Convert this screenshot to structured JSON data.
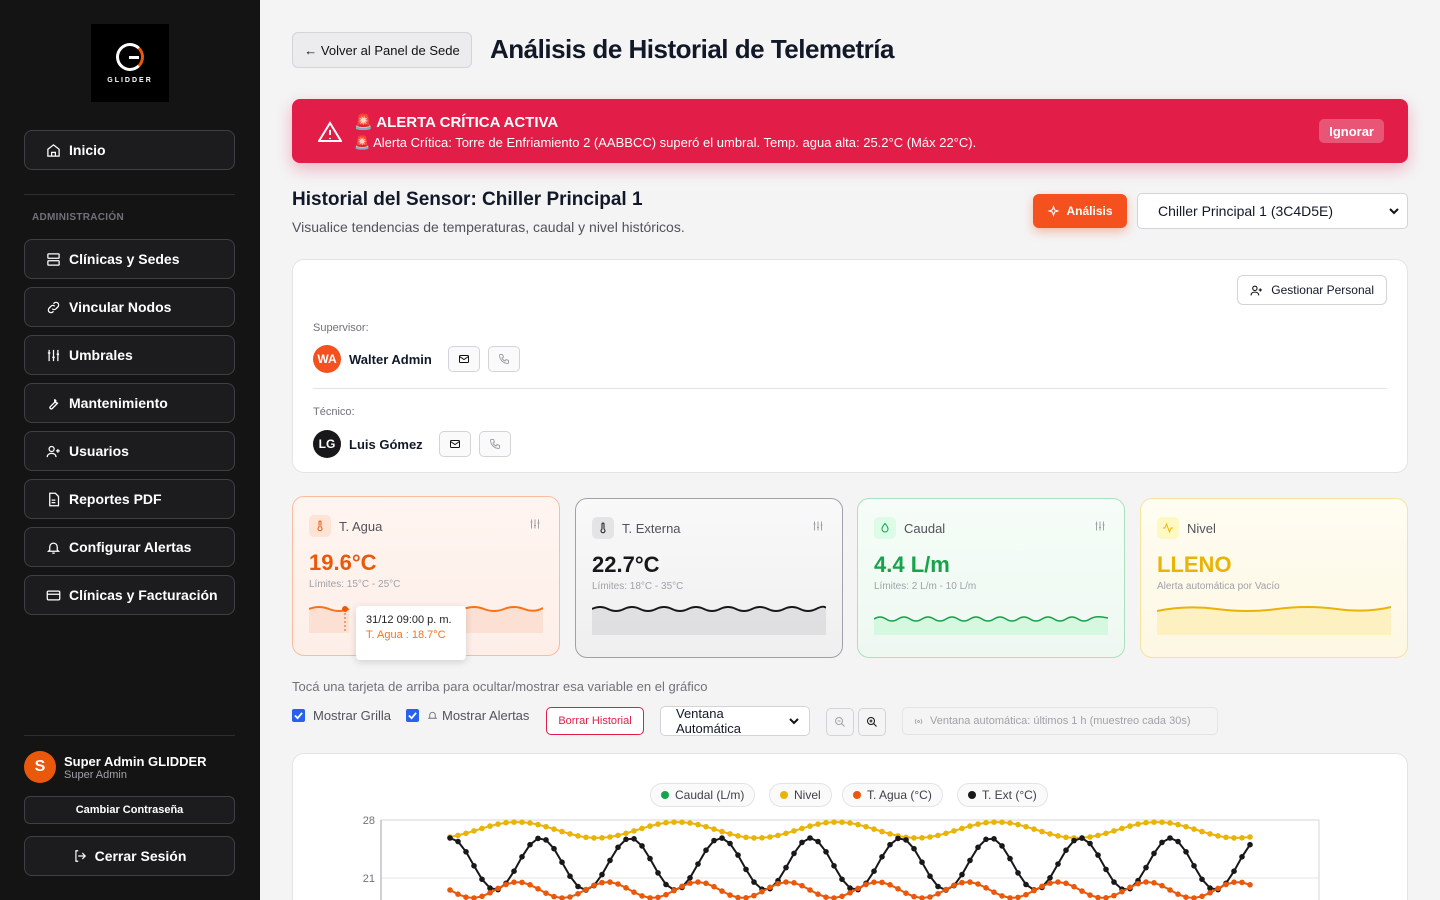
{
  "sidebar": {
    "logo_text": "GLIDDER",
    "home": "Inicio",
    "section_title": "ADMINISTRACIÓN",
    "items": [
      {
        "label": "Clínicas y Sedes",
        "icon": "server-icon"
      },
      {
        "label": "Vincular Nodos",
        "icon": "link-icon"
      },
      {
        "label": "Umbrales",
        "icon": "sliders-icon"
      },
      {
        "label": "Mantenimiento",
        "icon": "wrench-icon"
      },
      {
        "label": "Usuarios",
        "icon": "user-plus-icon"
      },
      {
        "label": "Reportes PDF",
        "icon": "file-icon"
      },
      {
        "label": "Configurar Alertas",
        "icon": "bell-icon"
      },
      {
        "label": "Clínicas y Facturación",
        "icon": "credit-card-icon"
      }
    ],
    "user": {
      "initial": "S",
      "name": "Super Admin GLIDDER",
      "role": "Super Admin"
    },
    "change_password": "Cambiar Contraseña",
    "logout": "Cerrar Sesión"
  },
  "header": {
    "back": "← Volver al Panel de Sede",
    "title": "Análisis de Historial de Telemetría"
  },
  "alert": {
    "title": "🚨 ALERTA CRÍTICA ACTIVA",
    "message": "🚨 Alerta Crítica: Torre de Enfriamiento 2 (AABBCC) superó el umbral. Temp. agua alta: 25.2°C (Máx 22°C).",
    "dismiss": "Ignorar",
    "color": "#e11d48"
  },
  "sensor": {
    "title": "Historial del Sensor: Chiller Principal 1",
    "subtitle": "Visualice tendencias de temperaturas, caudal y nivel históricos.",
    "analysis_btn": "Análisis",
    "selected": "Chiller Principal 1 (3C4D5E)"
  },
  "staff": {
    "manage": "Gestionar Personal",
    "supervisor_label": "Supervisor:",
    "supervisor": {
      "initials": "WA",
      "name": "Walter Admin"
    },
    "tech_label": "Técnico:",
    "tech": {
      "initials": "LG",
      "name": "Luis Gómez"
    }
  },
  "metrics": [
    {
      "label": "T. Agua",
      "value": "19.6°C",
      "limits": "Límites: 15°C - 25°C",
      "color": "#ea580c"
    },
    {
      "label": "T. Externa",
      "value": "22.7°C",
      "limits": "Límites: 18°C - 35°C",
      "color": "#18181b"
    },
    {
      "label": "Caudal",
      "value": "4.4 L/m",
      "limits": "Límites: 2 L/m - 10 L/m",
      "color": "#16a34a"
    },
    {
      "label": "Nivel",
      "value": "LLENO",
      "limits": "Alerta automática por Vacío",
      "color": "#eab308"
    }
  ],
  "tooltip": {
    "time": "31/12 09:00 p. m.",
    "value": "T. Agua : 18.7°C"
  },
  "controls": {
    "hint": "Tocá una tarjeta de arriba para ocultar/mostrar esa variable en el gráfico",
    "show_grid": "Mostrar Grilla",
    "show_alerts": "Mostrar Alertas",
    "clear": "Borrar Historial",
    "window": "Ventana Automática",
    "window_info": "Ventana automática: últimos 1 h (muestreo cada 30s)"
  },
  "chart_data": {
    "type": "line",
    "y_ticks": [
      "28",
      "21"
    ],
    "legend": [
      {
        "name": "Caudal (L/m)",
        "color": "#16a34a"
      },
      {
        "name": "Nivel",
        "color": "#eab308"
      },
      {
        "name": "T. Agua (°C)",
        "color": "#ea580c"
      },
      {
        "name": "T. Ext (°C)",
        "color": "#18181b"
      }
    ]
  }
}
